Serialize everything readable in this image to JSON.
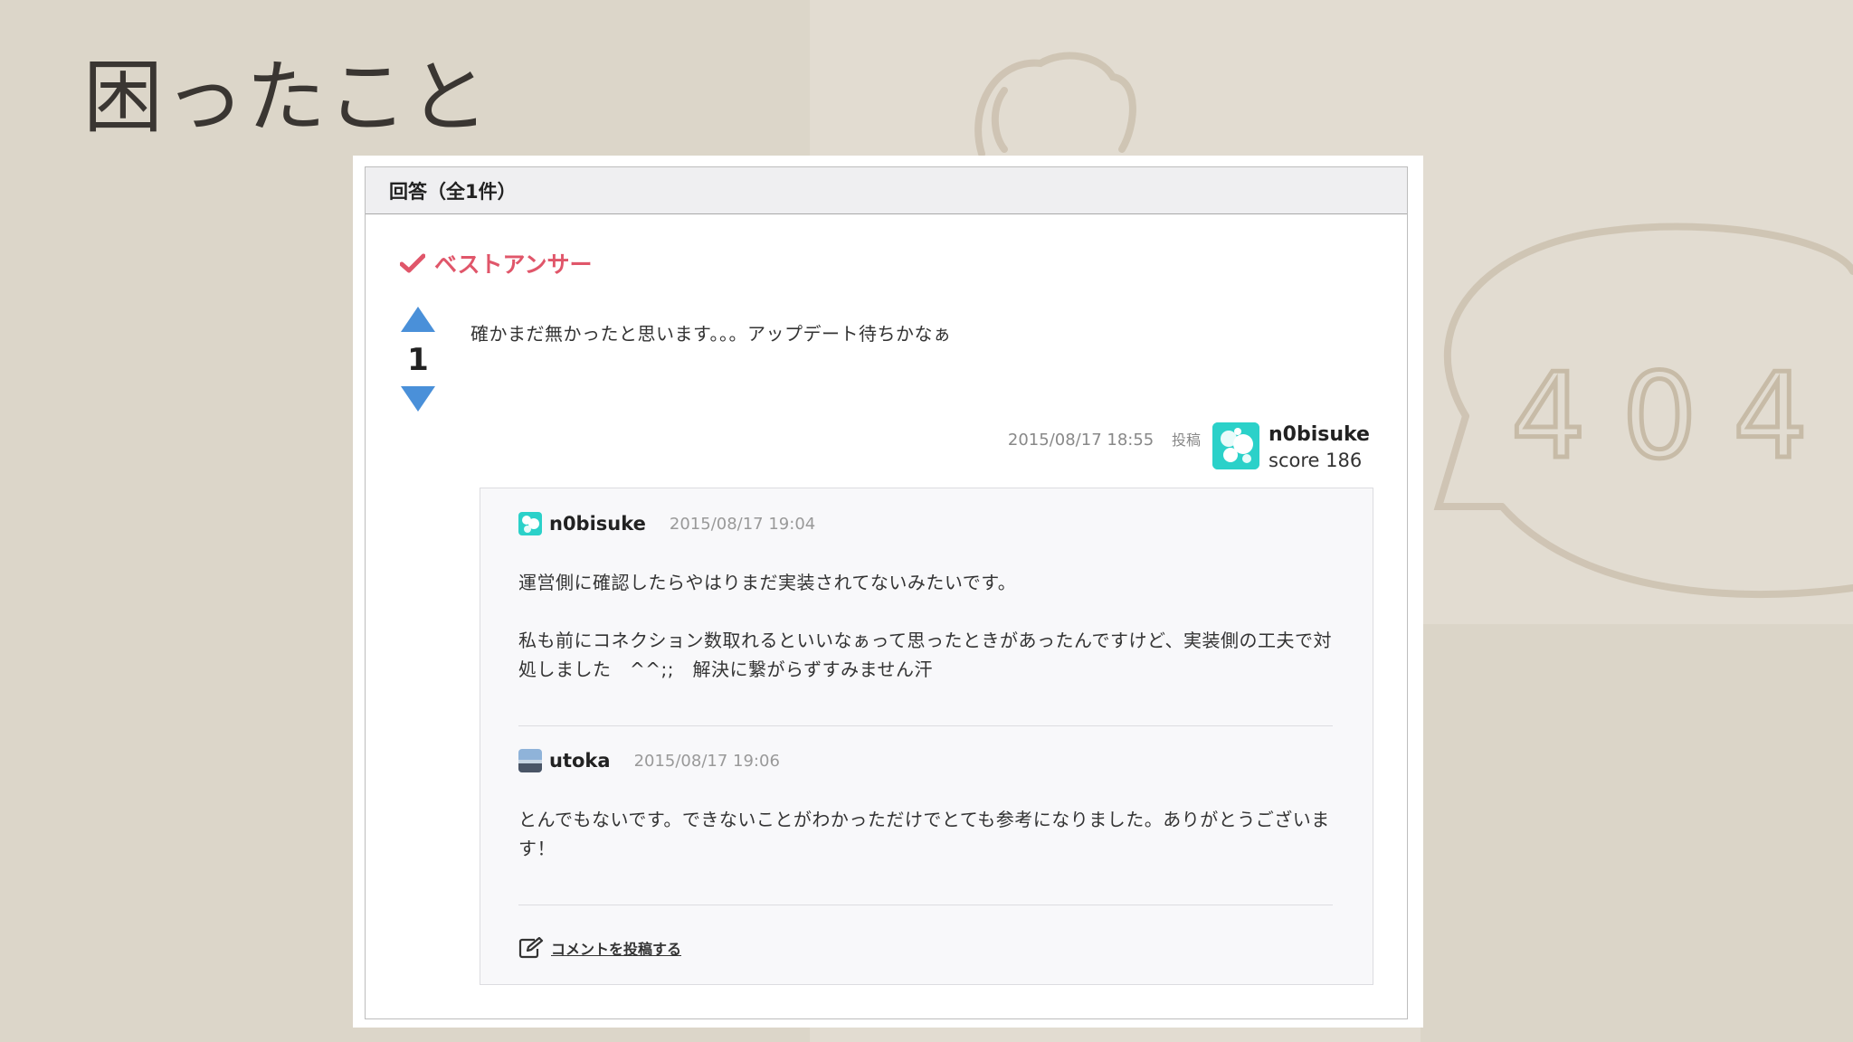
{
  "slide": {
    "title": "困ったこと"
  },
  "panel": {
    "header": "回答（全1件）",
    "best_answer_label": "ベストアンサー",
    "vote_count": "1",
    "answer_text": "確かまだ無かったと思います。。。アップデート待ちかなぁ",
    "posted_at": "2015/08/17 18:55",
    "posted_label": "投稿",
    "author": {
      "name": "n0bisuke",
      "score": "score 186"
    }
  },
  "comments": [
    {
      "user": "n0bisuke",
      "date": "2015/08/17 19:04",
      "paragraphs": [
        "運営側に確認したらやはりまだ実装されてないみたいです。",
        "私も前にコネクション数取れるといいなぁって思ったときがあったんですけど、実装側の工夫で対処しました　^^;;　解決に繋がらずすみません汗"
      ]
    },
    {
      "user": "utoka",
      "date": "2015/08/17 19:06",
      "paragraphs": [
        "とんでもないです。できないことがわかっただけでとても参考になりました。ありがとうございます！"
      ]
    }
  ],
  "post_comment_label": "コメントを投稿する",
  "background_sketch_text": "404",
  "colors": {
    "best_answer": "#e0566a",
    "vote_arrow": "#4a90d9",
    "avatar_teal": "#2bd1c9"
  }
}
